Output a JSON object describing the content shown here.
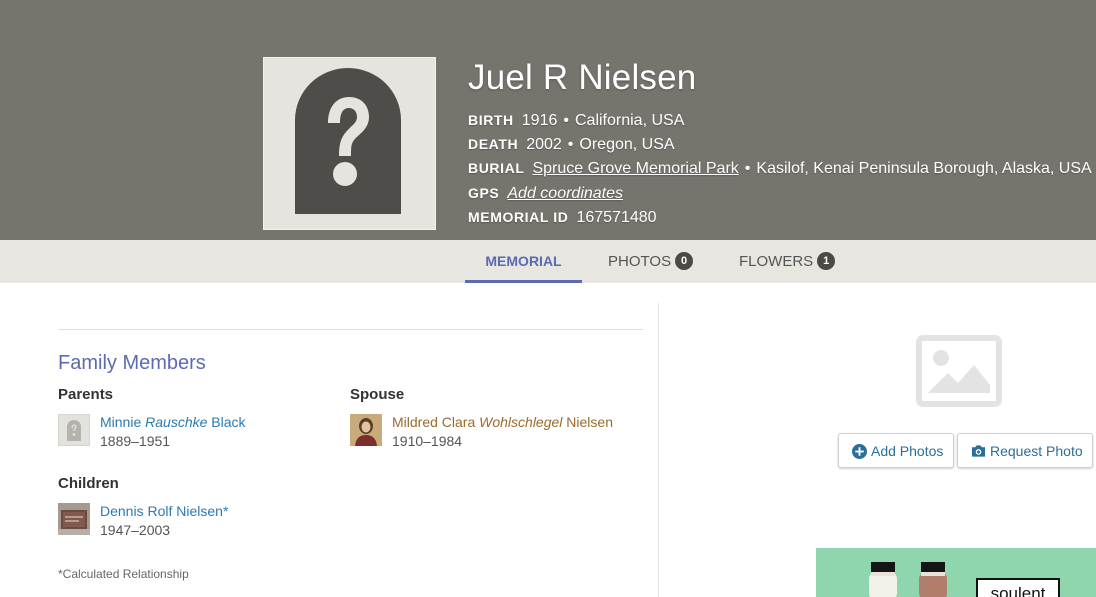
{
  "memorial": {
    "name": "Juel R Nielsen",
    "birth": {
      "label": "BIRTH",
      "year": "1916",
      "place": "California, USA"
    },
    "death": {
      "label": "DEATH",
      "year": "2002",
      "place": "Oregon, USA"
    },
    "burial": {
      "label": "BURIAL",
      "cemetery": "Spruce Grove Memorial Park",
      "place": "Kasilof, Kenai Peninsula Borough, Alaska, USA"
    },
    "gps": {
      "label": "GPS",
      "link": "Add coordinates"
    },
    "memorial_id": {
      "label": "MEMORIAL ID",
      "value": "167571480"
    }
  },
  "tabs": [
    {
      "label": "MEMORIAL"
    },
    {
      "label": "PHOTOS",
      "count": "0"
    },
    {
      "label": "FLOWERS",
      "count": "1"
    }
  ],
  "family": {
    "title": "Family Members",
    "parents_label": "Parents",
    "spouse_label": "Spouse",
    "children_label": "Children",
    "parent": {
      "first": "Minnie",
      "maiden": "Rauschke",
      "last": "Black",
      "years": "1889–1951"
    },
    "spouse": {
      "first": "Mildred Clara",
      "maiden": "Wohlschlegel",
      "last": "Nielsen",
      "years": "1910–1984"
    },
    "child": {
      "name": "Dennis Rolf Nielsen*",
      "years": "1947–2003"
    },
    "note": "*Calculated Relationship"
  },
  "photo_panel": {
    "add_photos": "Add Photos",
    "request_photo": "Request Photo"
  },
  "ad": {
    "text": "soulent"
  },
  "colors": {
    "header": "#77736d",
    "accent": "#5d6ab1",
    "link": "#2a7bb0",
    "spouse_link": "#9b6a2c"
  },
  "icons": [
    "question-mark-headstone-icon",
    "image-placeholder-icon",
    "plus-circle-icon",
    "camera-icon"
  ]
}
